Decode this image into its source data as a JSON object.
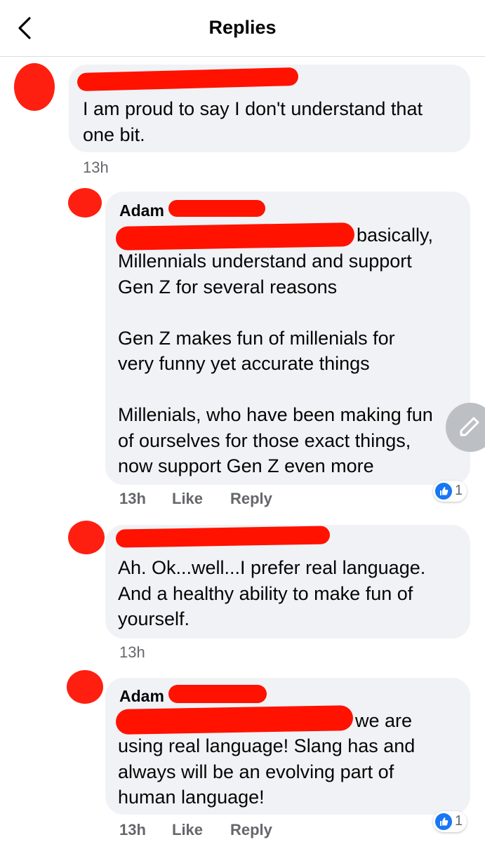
{
  "header": {
    "title": "Replies"
  },
  "comments": [
    {
      "author": "",
      "text": "I am proud to say I don't understand that\none bit.",
      "time": "13h"
    },
    {
      "author": "Adam",
      "text": "basically,",
      "text_rest": "Millennials understand and support\nGen Z for several reasons\n\nGen Z makes fun of millenials for\nvery funny yet accurate things\n\nMillenials, who have been making fun\nof ourselves for those exact things,\nnow support Gen Z even more",
      "time": "13h",
      "like_label": "Like",
      "reply_label": "Reply",
      "reaction_count": "1"
    },
    {
      "author": "",
      "text": "Ah. Ok...well...I prefer real language.\nAnd a healthy ability to make fun of\nyourself.",
      "time": "13h"
    },
    {
      "author": "Adam",
      "text": "we are",
      "text_rest": "using real language! Slang has and\nalways will be an evolving part of\nhuman language!",
      "time": "13h",
      "like_label": "Like",
      "reply_label": "Reply",
      "reaction_count": "1"
    }
  ],
  "colors": {
    "redaction": "#ff1200",
    "bubble": "#f0f2f5",
    "like_blue": "#1877f2"
  },
  "icons": {
    "back": "chevron-left-icon",
    "reaction": "thumbs-up-icon",
    "edit": "pencil-icon"
  }
}
